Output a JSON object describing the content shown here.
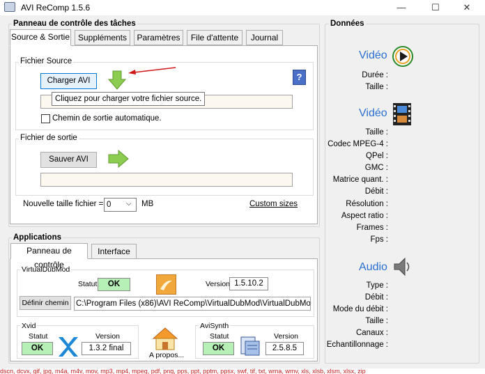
{
  "window": {
    "title": "AVI ReComp  1.5.6",
    "minimize": "—",
    "maximize": "☐",
    "close": "✕"
  },
  "control_panel": {
    "title": "Panneau de contrôle des tâches",
    "tabs": [
      "Source & Sortie",
      "Suppléments",
      "Paramètres",
      "File d'attente",
      "Journal"
    ],
    "source": {
      "group": "Fichier Source",
      "load_button": "Charger AVI",
      "tooltip": "Cliquez pour charger votre fichier source.",
      "auto_output_label": "Chemin de sortie automatique.",
      "help": "?"
    },
    "output": {
      "group": "Fichier de sortie",
      "save_button": "Sauver AVI",
      "new_size_label": "Nouvelle taille fichier =",
      "size_value": "0",
      "size_unit": "MB",
      "custom_sizes": "Custom sizes"
    }
  },
  "applications": {
    "title": "Applications",
    "tabs": [
      "Panneau de contrôle",
      "Interface"
    ],
    "vdm": {
      "group": "VirtualDubMod",
      "status_label": "Statut",
      "status": "OK",
      "version_label": "Version",
      "version": "1.5.10.2",
      "path_button": "Définir chemin",
      "path": "C:\\Program Files (x86)\\AVI ReComp\\VirtualDubMod\\VirtualDubMod.exe"
    },
    "xvid": {
      "group": "Xvid",
      "status_label": "Statut",
      "status": "OK",
      "version_label": "Version",
      "version": "1.3.2 final"
    },
    "about": "A propos...",
    "avisynth": {
      "group": "AviSynth",
      "status_label": "Statut",
      "status": "OK",
      "version_label": "Version",
      "version": "2.5.8.5"
    }
  },
  "data_panel": {
    "title": "Données",
    "video1": {
      "title": "Vidéo",
      "labels": [
        "Durée :",
        "Taille :"
      ]
    },
    "video2": {
      "title": "Vidéo",
      "labels": [
        "Taille :",
        "Codec MPEG-4 :",
        "QPel :",
        "GMC :",
        "Matrice quant. :",
        "Débit :",
        "Résolution :",
        "Aspect ratio :",
        "Frames :",
        "Fps :"
      ]
    },
    "audio": {
      "title": "Audio",
      "labels": [
        "Type :",
        "Débit :",
        "Mode du débit :",
        "Taille :",
        "Canaux :",
        "Echantillonnage :"
      ]
    }
  },
  "footer_text": "dscn, dcvx, gif, jpg, m4a, m4v, mov, mp3, mp4, mpeg, pdf, png, pps, ppt, pptm, ppsx, swf, tif, txt, wma, wmv, xls, xlsb, xlsm, xlsx, zip"
}
